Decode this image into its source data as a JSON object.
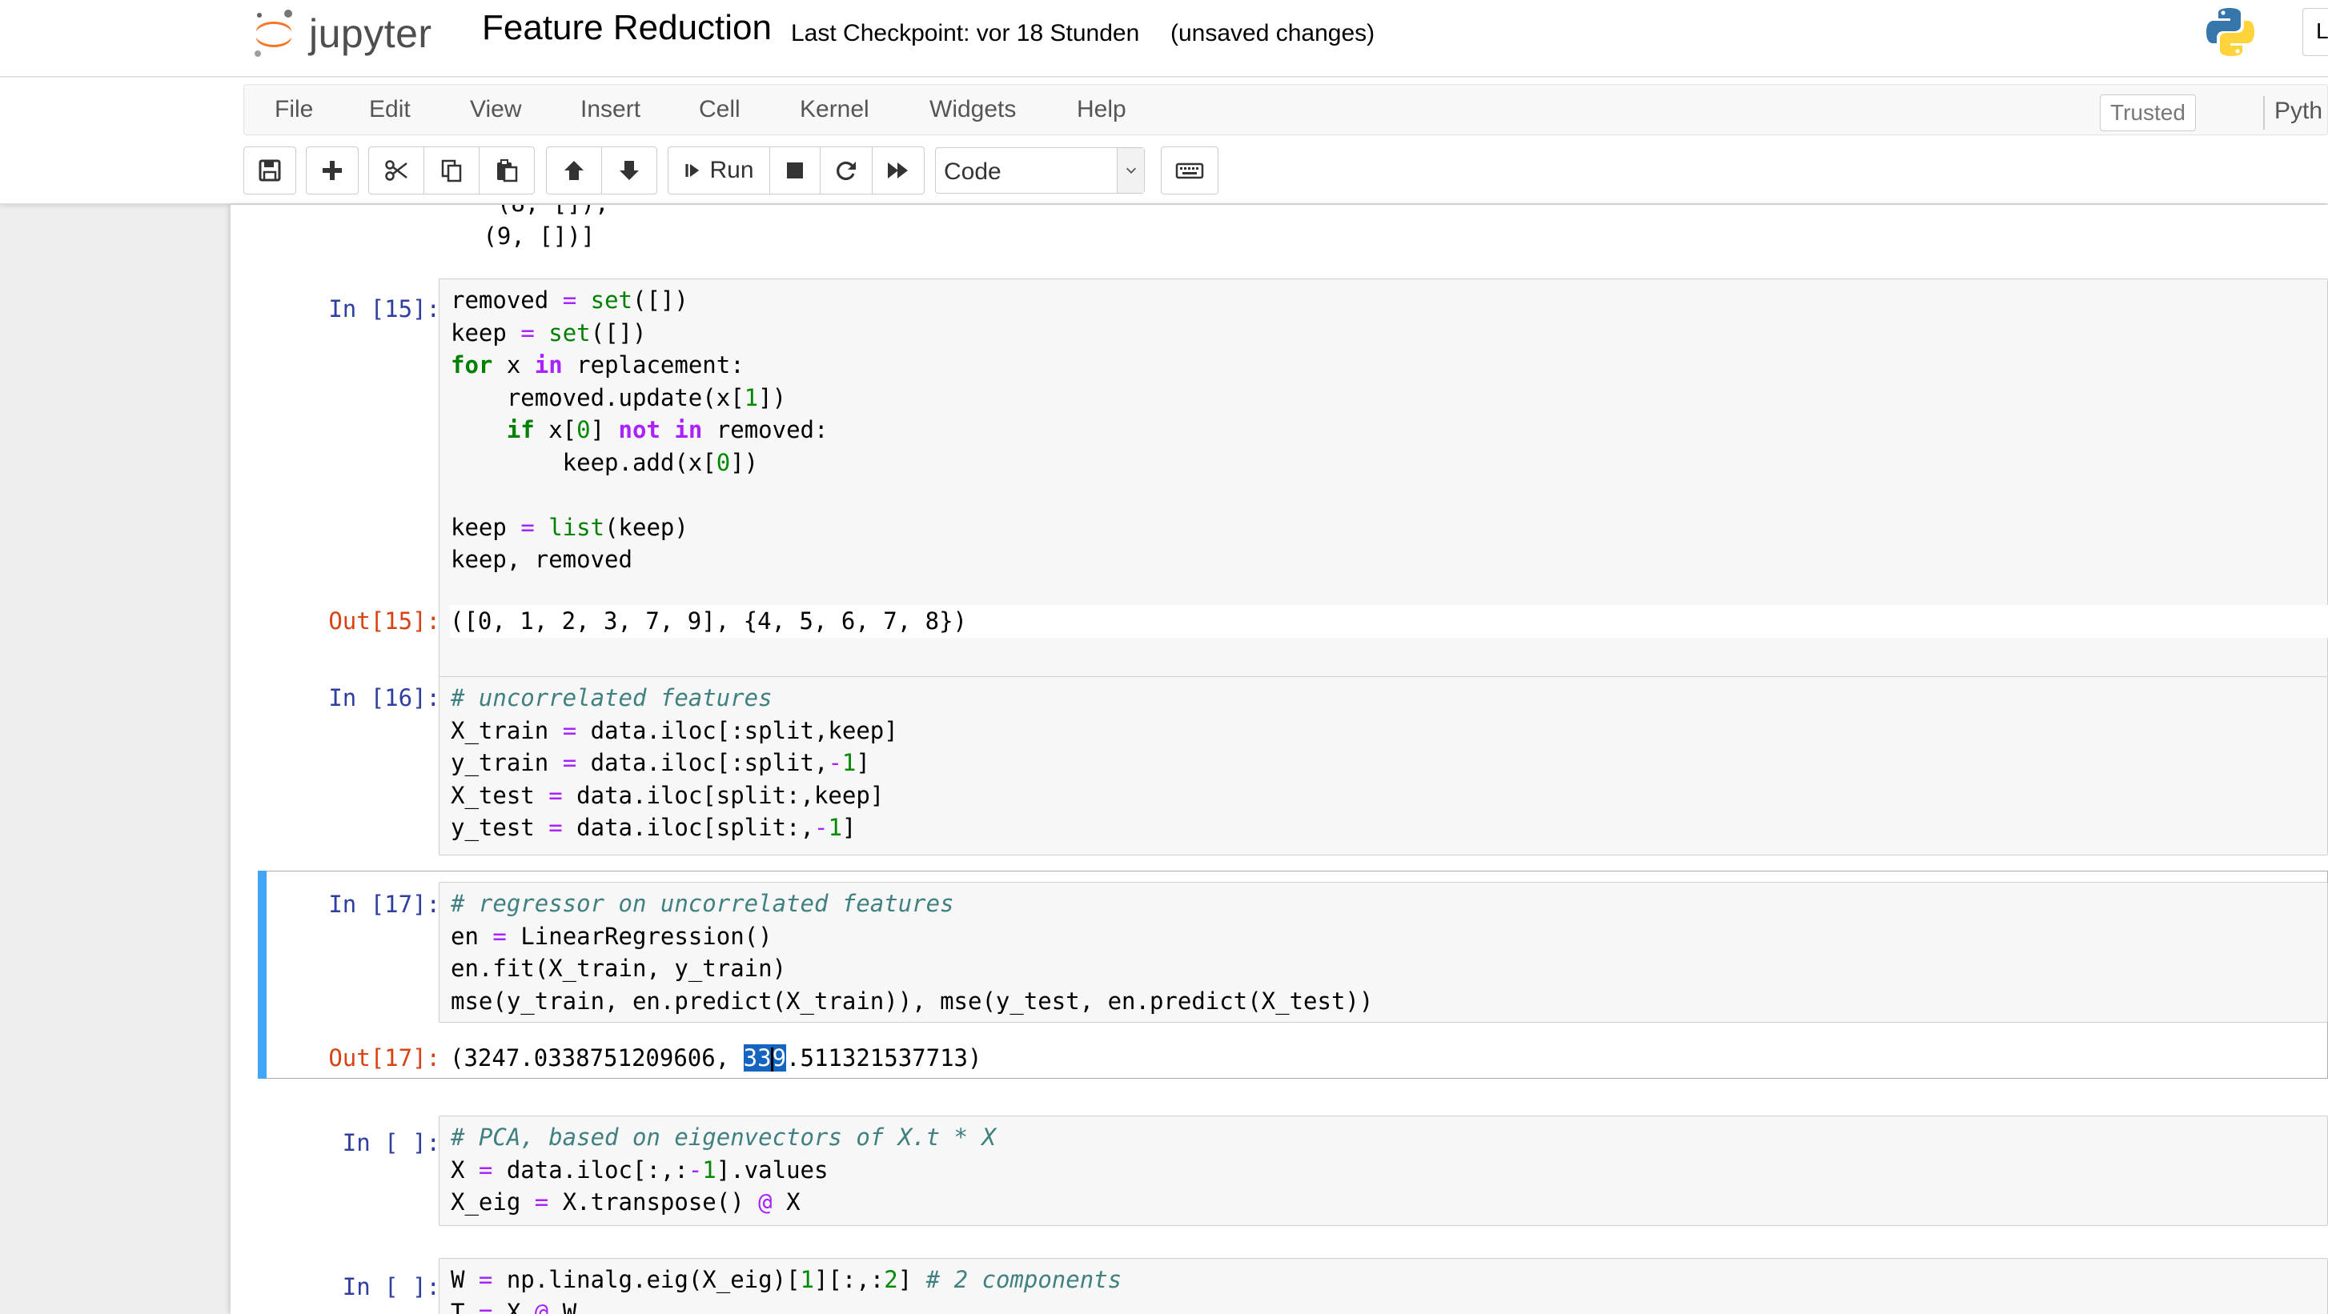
{
  "header": {
    "logo_text": "jupyter",
    "notebook_title": "Feature Reduction",
    "checkpoint": "Last Checkpoint: vor 18 Stunden",
    "unsaved": "(unsaved changes)",
    "user_button_partial": "L"
  },
  "menu": {
    "items": [
      "File",
      "Edit",
      "View",
      "Insert",
      "Cell",
      "Kernel",
      "Widgets",
      "Help"
    ],
    "trusted": "Trusted",
    "kernel_name": "Pyth"
  },
  "toolbar": {
    "run_label": "Run",
    "cell_type": "Code",
    "icons": [
      "save-icon",
      "plus-icon",
      "scissors-icon",
      "copy-icon",
      "paste-icon",
      "arrow-up-icon",
      "arrow-down-icon",
      "step-forward-icon",
      "stop-icon",
      "restart-icon",
      "fast-forward-icon",
      "chevron-down-icon",
      "keyboard-icon"
    ]
  },
  "cells": {
    "prev_output_tail": {
      "line1": "  (8, []),",
      "line2": " (9, [])]"
    },
    "c15": {
      "in_prompt": "In [15]:",
      "out_prompt": "Out[15]:",
      "output": "([0, 1, 2, 3, 7, 9], {4, 5, 6, 7, 8})"
    },
    "c16": {
      "in_prompt": "In [16]:"
    },
    "c17": {
      "in_prompt": "In [17]:",
      "out_prompt": "Out[17]:",
      "output_before": "(3247.0338751209606, ",
      "output_selected_a": "33",
      "output_selected_b": "9",
      "output_after": ".511321537713)"
    },
    "c_pca": {
      "in_prompt": "In [ ]:"
    },
    "c_w": {
      "in_prompt": "In [ ]:"
    }
  },
  "colors": {
    "prompt_in": "#303f9f",
    "prompt_out": "#d84315",
    "selected_cell_bar": "#42a5f5",
    "keyword": "#008000",
    "operator": "#aa22ff",
    "comment": "#408080"
  }
}
